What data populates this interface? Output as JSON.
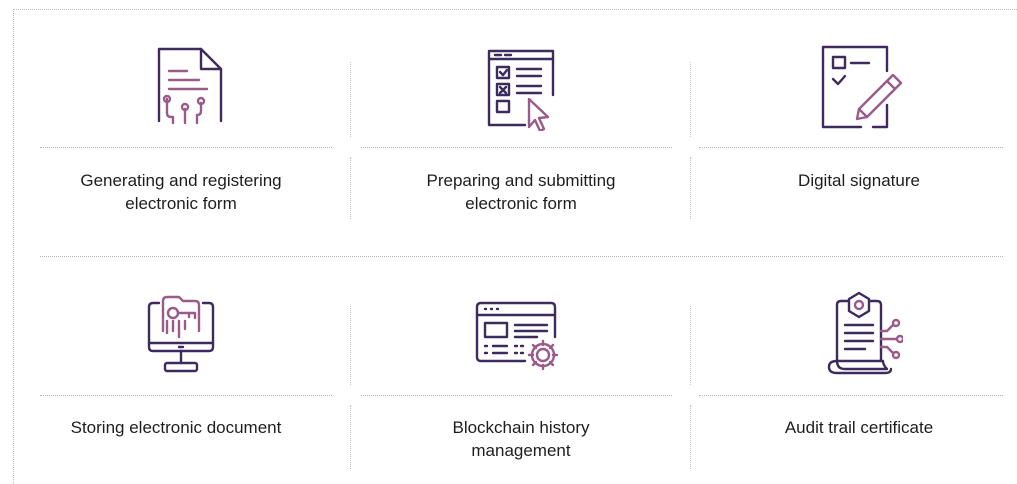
{
  "features": [
    {
      "lines": [
        "Generating and registering",
        "electronic form"
      ],
      "icon": "form-circuit-icon"
    },
    {
      "lines": [
        "Preparing and submitting",
        "electronic form"
      ],
      "icon": "checklist-cursor-icon"
    },
    {
      "lines": [
        "Digital signature"
      ],
      "icon": "signature-pencil-icon"
    },
    {
      "lines": [
        "Storing electronic document"
      ],
      "icon": "monitor-folder-key-icon"
    },
    {
      "lines": [
        "Blockchain history",
        "management"
      ],
      "icon": "browser-gear-icon"
    },
    {
      "lines": [
        "Audit trail certificate"
      ],
      "icon": "certificate-scroll-icon"
    }
  ],
  "colors": {
    "icon_primary": "#3d2a5e",
    "icon_accent": "#9a5a8a",
    "text": "#1e1e1e"
  }
}
